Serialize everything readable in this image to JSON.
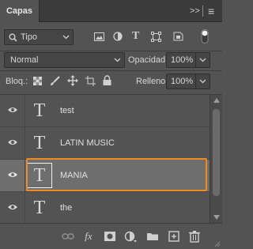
{
  "panel": {
    "tab_label": "Capas",
    "collapse_icon": "double-chevron-right-icon",
    "menu_icon": "hamburger-menu-icon",
    "collapse_glyph": ">>",
    "menu_glyph": "≡"
  },
  "filter": {
    "search_icon": "search-icon",
    "kind_value": "Tipo",
    "filter_icons": [
      "image-filter-icon",
      "adjustment-filter-icon",
      "type-filter-icon",
      "shape-filter-icon",
      "smart-object-filter-icon"
    ],
    "type_glyph": "T",
    "toggle_icon": "filter-toggle-icon"
  },
  "blend": {
    "mode_value": "Normal",
    "opacity_label": "Opacidad:",
    "opacity_value": "100%"
  },
  "lock": {
    "label": "Bloq.:",
    "icons": [
      "lock-transparent-pixels-icon",
      "lock-image-pixels-icon",
      "lock-position-icon",
      "lock-artboard-icon",
      "lock-all-icon"
    ],
    "fill_label": "Relleno:",
    "fill_value": "100%"
  },
  "layers": [
    {
      "name": "test",
      "type_glyph": "T",
      "visible": true,
      "selected": false
    },
    {
      "name": "LATIN MUSIC",
      "type_glyph": "T",
      "visible": true,
      "selected": false
    },
    {
      "name": "MANIA",
      "type_glyph": "T",
      "visible": true,
      "selected": true
    },
    {
      "name": "the",
      "type_glyph": "T",
      "visible": true,
      "selected": false
    }
  ],
  "footer": {
    "icons": [
      "link-layers-icon",
      "layer-style-fx-icon",
      "add-mask-icon",
      "adjustment-layer-icon",
      "new-group-folder-icon",
      "new-layer-icon",
      "delete-trash-icon"
    ],
    "fx_glyph": "fx"
  },
  "colors": {
    "panel_bg": "#535353",
    "selection_accent": "#f08a1a",
    "selected_row_bg": "#6e6e6e"
  }
}
